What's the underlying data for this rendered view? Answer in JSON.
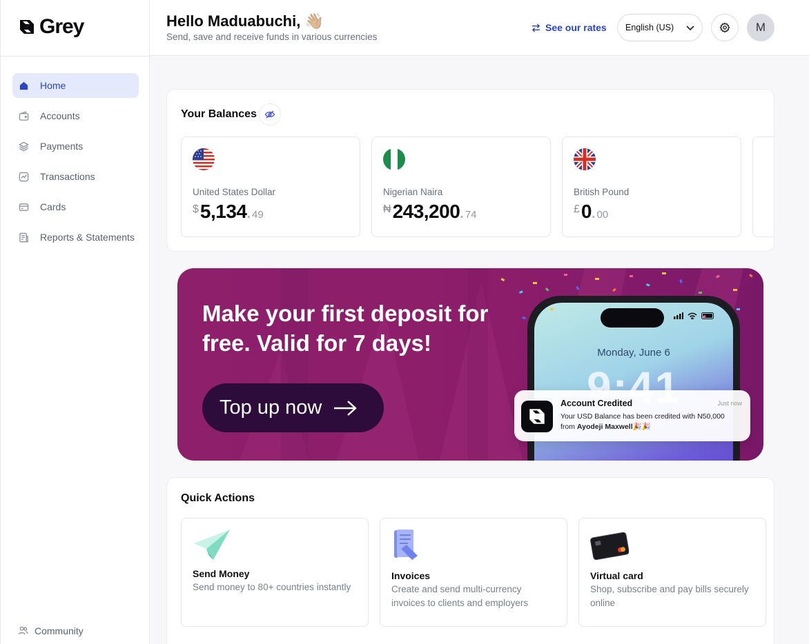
{
  "brand": {
    "name": "Grey"
  },
  "sidebar": {
    "items": [
      {
        "label": "Home",
        "icon": "home-icon",
        "active": true
      },
      {
        "label": "Accounts",
        "icon": "wallet-icon"
      },
      {
        "label": "Payments",
        "icon": "layers-icon"
      },
      {
        "label": "Transactions",
        "icon": "chart-icon"
      },
      {
        "label": "Cards",
        "icon": "card-icon"
      },
      {
        "label": "Reports & Statements",
        "icon": "report-icon"
      }
    ],
    "community": "Community"
  },
  "header": {
    "greeting": "Hello Maduabuchi, 👋🏼",
    "subtitle": "Send, save and receive funds in various currencies",
    "rates_label": "See our rates",
    "language": "English (US)",
    "avatar_initial": "M"
  },
  "balances": {
    "title": "Your Balances",
    "items": [
      {
        "name": "United States Dollar",
        "symbol": "$",
        "whole": "5,134",
        "decimal": "49"
      },
      {
        "name": "Nigerian Naira",
        "symbol": "₦",
        "whole": "243,200",
        "decimal": "74"
      },
      {
        "name": "British Pound",
        "symbol": "£",
        "whole": "0",
        "decimal": "00"
      }
    ]
  },
  "promo": {
    "headline": "Make your first deposit for free. Valid for 7 days!",
    "cta": "Top up now",
    "phone_date": "Monday, June 6",
    "phone_time": "9:41",
    "notification": {
      "title": "Account Credited",
      "time": "Just now",
      "body_line1": "Your USD Balance has been credited with  N50,000",
      "body_line2_prefix": "from ",
      "body_line2_name": "Ayodeji Maxwell🎉🎉"
    }
  },
  "quick_actions": {
    "title": "Quick Actions",
    "items": [
      {
        "title": "Send Money",
        "desc": "Send money to 80+ countries instantly"
      },
      {
        "title": "Invoices",
        "desc": "Create and send multi-currency invoices to clients and employers"
      },
      {
        "title": "Virtual card",
        "desc": "Shop, subscribe and pay bills securely online"
      }
    ]
  },
  "colors": {
    "accent": "#2A44C4",
    "promo_bg": "#8D1F6B",
    "cta_bg": "#2D0B3A"
  }
}
